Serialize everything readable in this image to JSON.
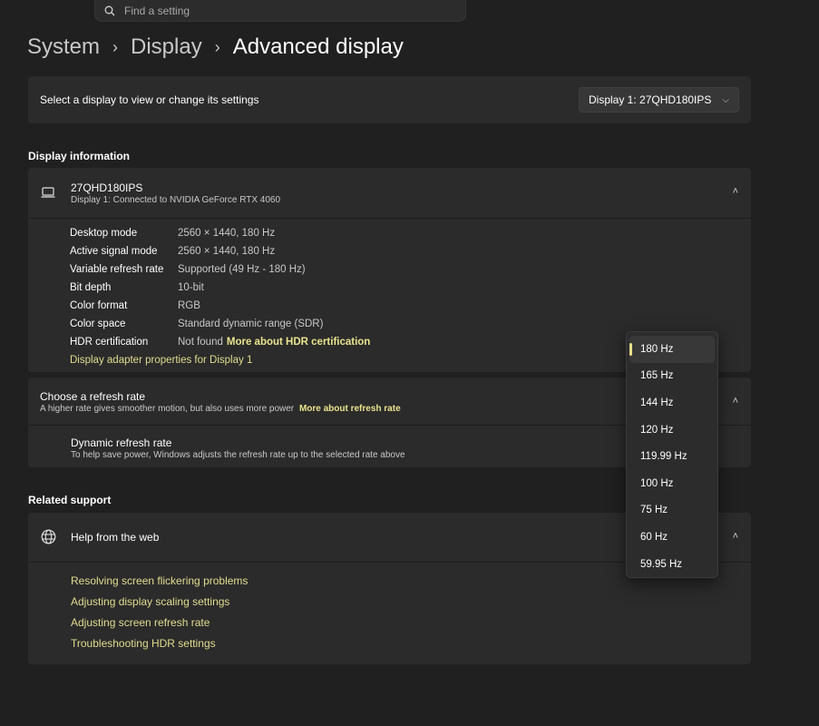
{
  "search": {
    "placeholder": "Find a setting",
    "icon": "search-icon"
  },
  "breadcrumb": {
    "items": [
      "System",
      "Display",
      "Advanced display"
    ],
    "separator": "›"
  },
  "display_select": {
    "label": "Select a display to view or change its settings",
    "value": "Display 1: 27QHD180IPS"
  },
  "display_info": {
    "section_title": "Display information",
    "monitor_name": "27QHD180IPS",
    "monitor_subtitle": "Display 1: Connected to NVIDIA GeForce RTX 4060",
    "rows": [
      {
        "key": "Desktop mode",
        "value": "2560 × 1440, 180 Hz"
      },
      {
        "key": "Active signal mode",
        "value": "2560 × 1440, 180 Hz"
      },
      {
        "key": "Variable refresh rate",
        "value": "Supported (49 Hz - 180 Hz)"
      },
      {
        "key": "Bit depth",
        "value": "10-bit"
      },
      {
        "key": "Color format",
        "value": "RGB"
      },
      {
        "key": "Color space",
        "value": "Standard dynamic range (SDR)"
      },
      {
        "key": "HDR certification",
        "value": "Not found",
        "link": "More about HDR certification"
      }
    ],
    "adapter_link": "Display adapter properties for Display 1"
  },
  "refresh_rate": {
    "title": "Choose a refresh rate",
    "subtitle": "A higher rate gives smoother motion, but also uses more power",
    "subtitle_link": "More about refresh rate",
    "dynamic_title": "Dynamic refresh rate",
    "dynamic_subtitle": "To help save power, Windows adjusts the refresh rate up to the selected rate above",
    "options": [
      "180 Hz",
      "165 Hz",
      "144 Hz",
      "120 Hz",
      "119.99 Hz",
      "100 Hz",
      "75 Hz",
      "60 Hz",
      "59.95 Hz"
    ],
    "selected": "180 Hz"
  },
  "related_support": {
    "section_title": "Related support",
    "help_title": "Help from the web",
    "links": [
      "Resolving screen flickering problems",
      "Adjusting display scaling settings",
      "Adjusting screen refresh rate",
      "Troubleshooting HDR settings"
    ]
  },
  "colors": {
    "background": "#202020",
    "card": "#2b2b2b",
    "accent_link": "#e0dc8f"
  }
}
